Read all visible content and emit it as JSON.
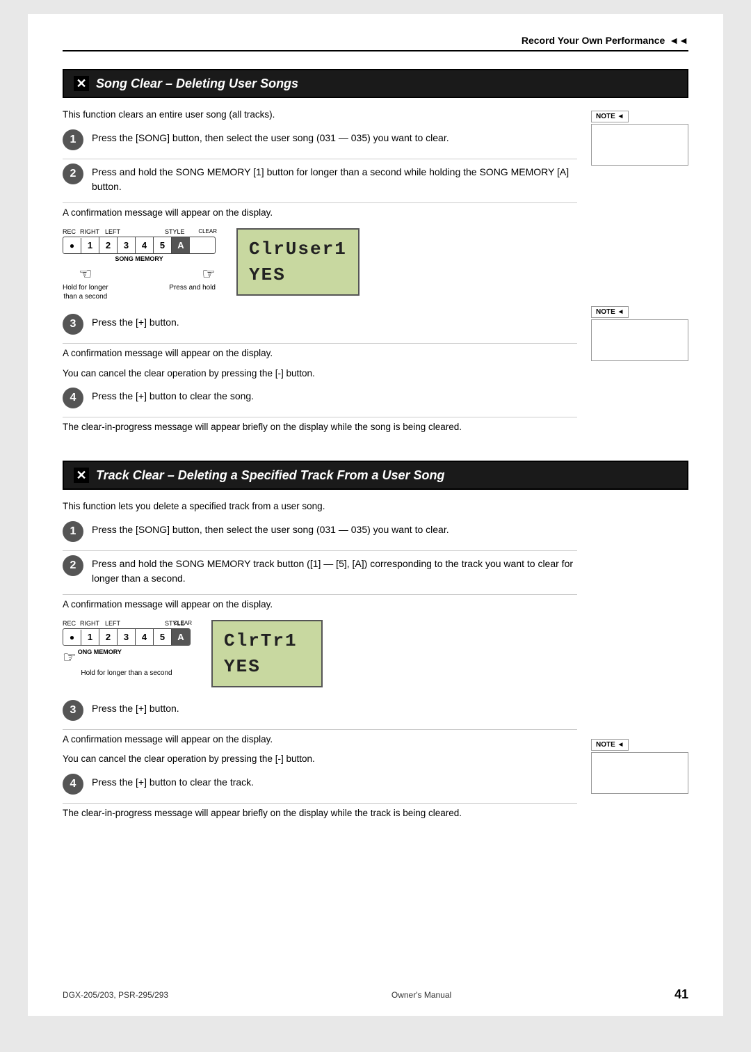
{
  "header": {
    "title": "Record Your Own Performance",
    "arrow": "◄◄"
  },
  "section1": {
    "title": "Song Clear – Deleting User Songs",
    "intro": "This function clears an entire user song (all tracks).",
    "steps": [
      {
        "number": "1",
        "text": "Press the [SONG] button, then select the user song (031 — 035) you want to clear."
      },
      {
        "number": "2",
        "text": "Press and hold the SONG MEMORY [1] button for longer than a second while holding the SONG MEMORY [A] button."
      }
    ],
    "confirmation_text1": "A confirmation message will appear on the display.",
    "step3": {
      "number": "3",
      "text": "Press the [+] button."
    },
    "confirmation_text2": "A confirmation message will appear on the display.",
    "cancel_text": "You can cancel the clear operation by pressing the [-] button.",
    "step4": {
      "number": "4",
      "text": "Press the [+] button to clear the song."
    },
    "clear_text": "The clear-in-progress message will appear briefly on the display while the song is being cleared.",
    "lcd1_line1": "ClrUser1",
    "lcd1_line2": "YES",
    "keyboard_labels": {
      "rec": "REC",
      "right": "RIGHT",
      "left": "LEFT",
      "style": "STYLE"
    },
    "keyboard_keys": [
      "●",
      "1",
      "2",
      "3",
      "4",
      "5",
      "A"
    ],
    "song_memory_label": "SONG MEMORY",
    "hold_text_left": "Hold for longer\nthan a second",
    "hold_text_right": "Press and hold",
    "clear_small": "CLEAR"
  },
  "section2": {
    "title": "Track Clear – Deleting a Specified Track From a User Song",
    "intro": "This function lets you delete a specified track from a user song.",
    "steps": [
      {
        "number": "1",
        "text": "Press the [SONG] button, then select the user song (031 — 035) you want to clear."
      },
      {
        "number": "2",
        "text": "Press  and hold  the SONG MEMORY track button ([1] — [5], [A]) corresponding to the track you want to clear for longer than a second."
      }
    ],
    "confirmation_text1": "A confirmation message will appear on the display.",
    "step3": {
      "number": "3",
      "text": "Press the [+] button."
    },
    "confirmation_text2": "A confirmation message will appear on the display.",
    "cancel_text": "You can cancel the clear operation by pressing the [-] button.",
    "step4": {
      "number": "4",
      "text": "Press the [+] button to clear the track."
    },
    "clear_text": "The clear-in-progress message will appear briefly on the display while the track is being cleared.",
    "lcd2_line1": "ClrTr1",
    "lcd2_line2": "YES",
    "hold_text": "Hold for longer than a second",
    "song_memory_label2": "ONG MEMORY",
    "clear_small2": "CLEAR"
  },
  "footer": {
    "model": "DGX-205/203, PSR-295/293",
    "manual": "Owner's Manual",
    "page": "41"
  }
}
